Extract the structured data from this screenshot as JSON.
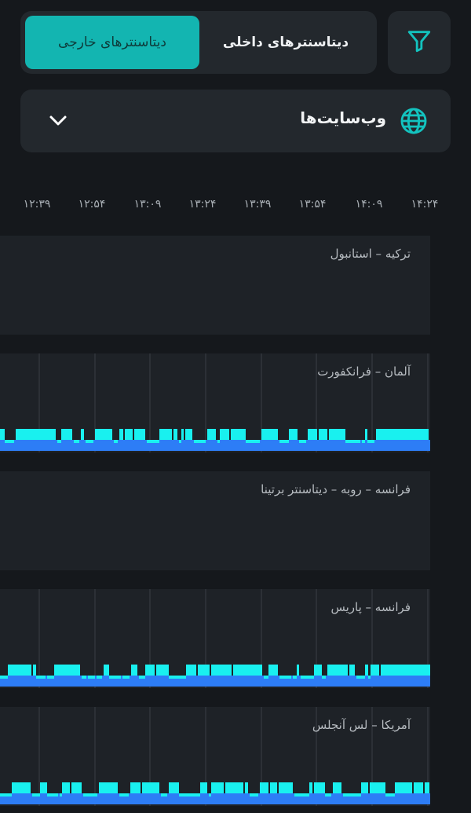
{
  "tabs": {
    "external_label": "دیتاسنترهای خارجی",
    "internal_label": "دیتاسنترهای داخلی",
    "active": "external"
  },
  "filter": {
    "icon": "filter-icon"
  },
  "selector": {
    "label": "وب‌سایت‌ها",
    "icon": "globe-icon",
    "chevron": "chevron-down-icon"
  },
  "time_axis": [
    "۱۲:۳۹",
    "۱۲:۵۴",
    "۱۳:۰۹",
    "۱۳:۲۴",
    "۱۳:۳۹",
    "۱۳:۵۴",
    "۱۴:۰۹",
    "۱۴:۲۴"
  ],
  "panels": [
    {
      "title": "ترکیه – استانبول",
      "has_data": false
    },
    {
      "title": "آلمان – فرانکفورت",
      "has_data": true,
      "seed": 3
    },
    {
      "title": "فرانسه – روبه – دیتاسنتر برتینا",
      "has_data": false
    },
    {
      "title": "فرانسه – پاریس",
      "has_data": true,
      "seed": 7
    },
    {
      "title": "آمریکا – لس آنجلس",
      "has_data": true,
      "seed": 11
    }
  ],
  "colors": {
    "background": "#15181c",
    "card": "#23282d",
    "panel": "#1e2227",
    "accent": "#13b5b1",
    "bar_cyan": "#19f0ef",
    "bar_blue": "#2d7df6",
    "grid": "#3a3f45"
  }
}
